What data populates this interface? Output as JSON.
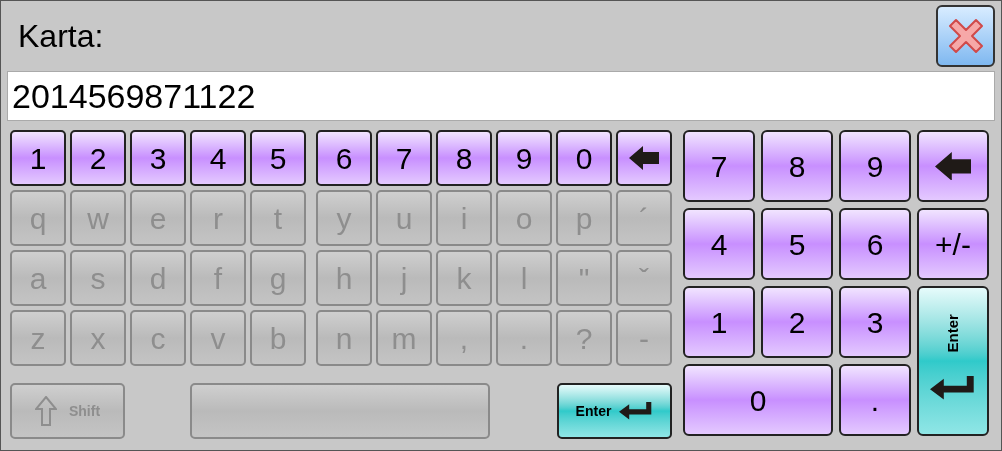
{
  "title": "Karta:",
  "field": {
    "value": "2014569871122"
  },
  "keyboard": {
    "rows": [
      [
        {
          "label": "1",
          "disabled": false
        },
        {
          "label": "2",
          "disabled": false
        },
        {
          "label": "3",
          "disabled": false
        },
        {
          "label": "4",
          "disabled": false
        },
        {
          "label": "5",
          "disabled": false
        },
        {
          "label": "6",
          "disabled": false
        },
        {
          "label": "7",
          "disabled": false
        },
        {
          "label": "8",
          "disabled": false
        },
        {
          "label": "9",
          "disabled": false
        },
        {
          "label": "0",
          "disabled": false
        },
        {
          "kind": "backspace",
          "disabled": false
        }
      ],
      [
        {
          "label": "q",
          "disabled": true
        },
        {
          "label": "w",
          "disabled": true
        },
        {
          "label": "e",
          "disabled": true
        },
        {
          "label": "r",
          "disabled": true
        },
        {
          "label": "t",
          "disabled": true
        },
        {
          "label": "y",
          "disabled": true
        },
        {
          "label": "u",
          "disabled": true
        },
        {
          "label": "i",
          "disabled": true
        },
        {
          "label": "o",
          "disabled": true
        },
        {
          "label": "p",
          "disabled": true
        },
        {
          "label": "´",
          "disabled": true
        }
      ],
      [
        {
          "label": "a",
          "disabled": true
        },
        {
          "label": "s",
          "disabled": true
        },
        {
          "label": "d",
          "disabled": true
        },
        {
          "label": "f",
          "disabled": true
        },
        {
          "label": "g",
          "disabled": true
        },
        {
          "label": "h",
          "disabled": true
        },
        {
          "label": "j",
          "disabled": true
        },
        {
          "label": "k",
          "disabled": true
        },
        {
          "label": "l",
          "disabled": true
        },
        {
          "label": "\"",
          "disabled": true
        },
        {
          "label": "ˇ",
          "disabled": true
        }
      ],
      [
        {
          "label": "z",
          "disabled": true
        },
        {
          "label": "x",
          "disabled": true
        },
        {
          "label": "c",
          "disabled": true
        },
        {
          "label": "v",
          "disabled": true
        },
        {
          "label": "b",
          "disabled": true
        },
        {
          "label": "n",
          "disabled": true
        },
        {
          "label": "m",
          "disabled": true
        },
        {
          "label": ",",
          "disabled": true
        },
        {
          "label": ".",
          "disabled": true
        },
        {
          "label": "?",
          "disabled": true
        },
        {
          "label": "-",
          "disabled": true
        }
      ]
    ],
    "bottom": [
      {
        "kind": "shift",
        "label": "Shift",
        "disabled": true
      },
      {
        "kind": "space",
        "disabled": true
      },
      {
        "kind": "enter",
        "label": "Enter",
        "disabled": false
      }
    ]
  },
  "numpad": [
    {
      "kind": "key",
      "label": "7"
    },
    {
      "kind": "key",
      "label": "8"
    },
    {
      "kind": "key",
      "label": "9"
    },
    {
      "kind": "backspace"
    },
    {
      "kind": "key",
      "label": "4"
    },
    {
      "kind": "key",
      "label": "5"
    },
    {
      "kind": "key",
      "label": "6"
    },
    {
      "kind": "key",
      "label": "+/-"
    },
    {
      "kind": "key",
      "label": "1"
    },
    {
      "kind": "key",
      "label": "2"
    },
    {
      "kind": "key",
      "label": "3"
    },
    {
      "kind": "enter",
      "label": "Enter"
    },
    {
      "kind": "wide",
      "label": "0"
    },
    {
      "kind": "key",
      "label": "."
    }
  ]
}
